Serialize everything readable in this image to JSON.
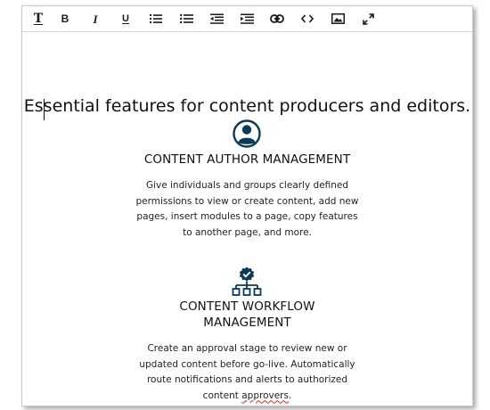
{
  "toolbar": {
    "buttons": [
      {
        "name": "text-style",
        "glyph": "T"
      },
      {
        "name": "bold",
        "glyph": "B"
      },
      {
        "name": "italic",
        "glyph": "I"
      },
      {
        "name": "underline",
        "glyph": "U"
      },
      {
        "name": "ordered-list",
        "icon": "ordered-list-icon"
      },
      {
        "name": "bullet-list",
        "icon": "bullet-list-icon"
      },
      {
        "name": "outdent",
        "icon": "outdent-icon"
      },
      {
        "name": "indent",
        "icon": "indent-icon"
      },
      {
        "name": "link",
        "icon": "link-icon"
      },
      {
        "name": "code",
        "icon": "code-icon"
      },
      {
        "name": "image",
        "icon": "image-icon"
      },
      {
        "name": "fullscreen",
        "icon": "expand-icon"
      }
    ]
  },
  "content": {
    "headline": "Essential features for content producers and editors.",
    "features": [
      {
        "icon": "user-avatar-icon",
        "title_lines": [
          "CONTENT AUTHOR MANAGEMENT"
        ],
        "description_lines": [
          "Give individuals and groups clearly defined",
          "permissions to view or create content, add new",
          "pages, insert modules to a page, copy features",
          "to another page, and more."
        ]
      },
      {
        "icon": "workflow-hierarchy-icon",
        "title_lines": [
          "CONTENT WORKFLOW",
          "MANAGEMENT"
        ],
        "description_lines": [
          "Create an approval stage to review new or",
          "updated content before go-live. Automatically",
          "route notifications and alerts to authorized"
        ],
        "description_last_line": {
          "before": "content ",
          "misspelled": "approvers",
          "after": "."
        }
      }
    ]
  },
  "colors": {
    "icon": "#0d3a57",
    "text": "#111111",
    "spellcheck": "#dd2222"
  }
}
